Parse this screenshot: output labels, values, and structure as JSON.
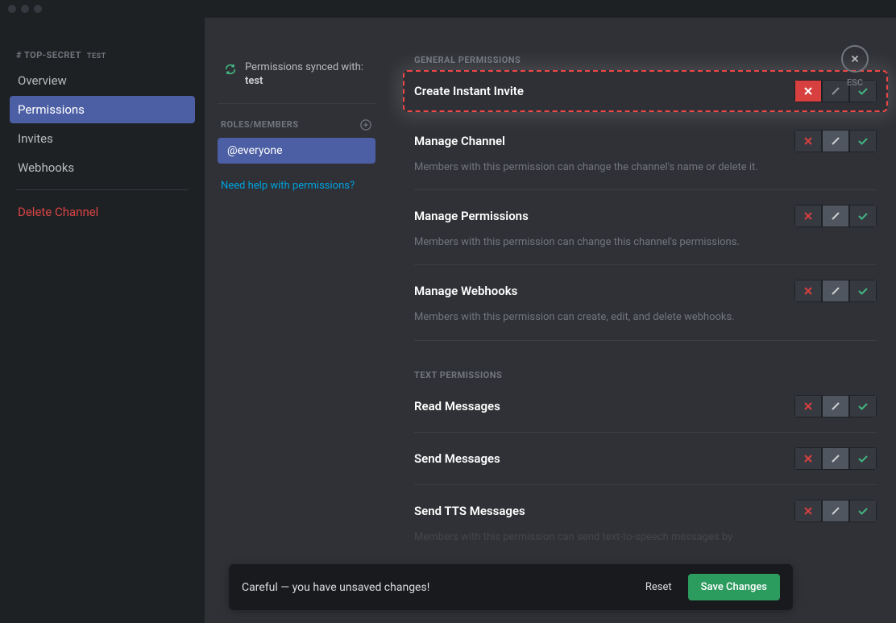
{
  "sidebar": {
    "header": "# TOP-SECRET",
    "header_sub": "TEST",
    "items": [
      {
        "label": "Overview",
        "active": false
      },
      {
        "label": "Permissions",
        "active": true
      },
      {
        "label": "Invites",
        "active": false
      },
      {
        "label": "Webhooks",
        "active": false
      }
    ],
    "delete_label": "Delete Channel"
  },
  "middle": {
    "sync_label": "Permissions synced with:",
    "sync_value": "test",
    "roles_header": "ROLES/MEMBERS",
    "role_item": "@everyone",
    "help_link": "Need help with permissions?"
  },
  "main": {
    "general_header": "GENERAL PERMISSIONS",
    "text_header": "TEXT PERMISSIONS",
    "permissions": {
      "create_invite": {
        "title": "Create Instant Invite",
        "state": "deny"
      },
      "manage_channel": {
        "title": "Manage Channel",
        "desc": "Members with this permission can change the channel's name or delete it.",
        "state": "pass"
      },
      "manage_permissions": {
        "title": "Manage Permissions",
        "desc": "Members with this permission can change this channel's permissions.",
        "state": "pass"
      },
      "manage_webhooks": {
        "title": "Manage Webhooks",
        "desc": "Members with this permission can create, edit, and delete webhooks.",
        "state": "pass"
      },
      "read_messages": {
        "title": "Read Messages",
        "state": "pass"
      },
      "send_messages": {
        "title": "Send Messages",
        "state": "pass"
      },
      "send_tts": {
        "title": "Send TTS Messages",
        "desc": "Members with this permission can send text-to-speech messages by",
        "state": "pass"
      }
    }
  },
  "close": {
    "label": "ESC"
  },
  "unsaved": {
    "text": "Careful — you have unsaved changes!",
    "reset": "Reset",
    "save": "Save Changes"
  }
}
